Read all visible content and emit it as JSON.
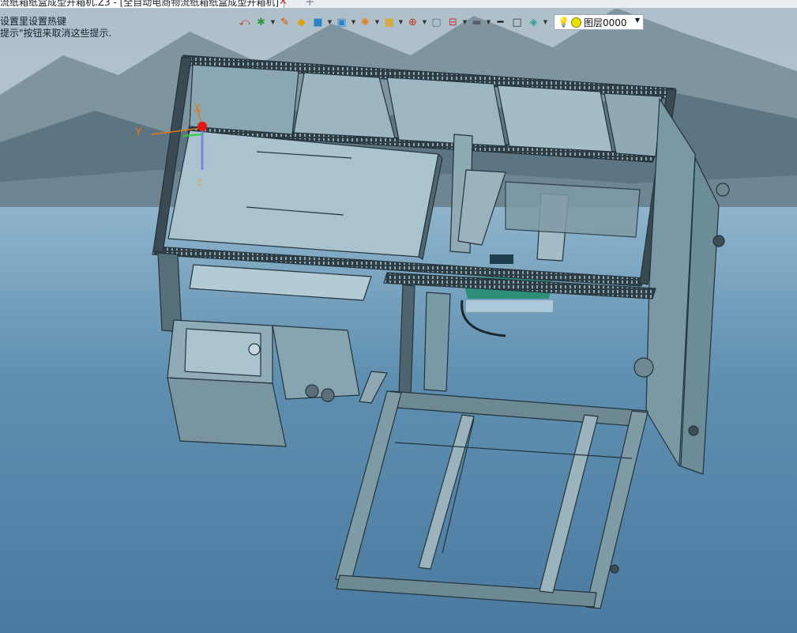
{
  "tab": {
    "title": "流纸箱纸盒成型开箱机.Z3 - [全自动电商物流纸箱纸盒成型开箱机]",
    "close_glyph": "✕",
    "add_glyph": "+"
  },
  "hints": {
    "line1": "设置里设置热键",
    "line2": "提示\"按钮来取消这些提示."
  },
  "toolbar": {
    "buttons": [
      {
        "name": "undo-view-icon",
        "glyph": "⤺",
        "color": "#c0392b"
      },
      {
        "name": "paint-icon",
        "glyph": "✱",
        "color": "#2e9a3e"
      },
      {
        "name": "pencil-icon",
        "glyph": "✎",
        "color": "#d35400"
      },
      {
        "name": "box-icon",
        "glyph": "◆",
        "color": "#e1a100"
      },
      {
        "name": "cube-icon",
        "glyph": "■",
        "color": "#2b83c6"
      },
      {
        "name": "view-cube-icon",
        "glyph": "▣",
        "color": "#2b83c6"
      },
      {
        "name": "render-icon",
        "glyph": "✺",
        "color": "#e67e22"
      },
      {
        "name": "shade-icon",
        "glyph": "▩",
        "color": "#e1a100"
      },
      {
        "name": "crosshair-icon",
        "glyph": "⊕",
        "color": "#c0392b"
      },
      {
        "name": "frame-icon",
        "glyph": "▢",
        "color": "#4a6f8f"
      },
      {
        "name": "section-icon",
        "glyph": "⊟",
        "color": "#c0392b"
      },
      {
        "name": "display-icon",
        "glyph": "▬",
        "color": "#55606b"
      },
      {
        "name": "line-style-icon",
        "glyph": "━",
        "color": "#111111"
      },
      {
        "name": "rect-icon",
        "glyph": "□",
        "color": "#333333"
      },
      {
        "name": "layers-icon",
        "glyph": "◈",
        "color": "#2aa198"
      }
    ],
    "layer": {
      "label": "图层0000"
    }
  },
  "axes": {
    "x": "X",
    "y": "Y",
    "z": "Z"
  },
  "colors": {
    "machine_fill": "#8fb2bf",
    "machine_stroke": "#2a3a42",
    "frame_dark": "#3c4a52",
    "sky": "#7fa3bf",
    "water": "#5a86a6"
  }
}
